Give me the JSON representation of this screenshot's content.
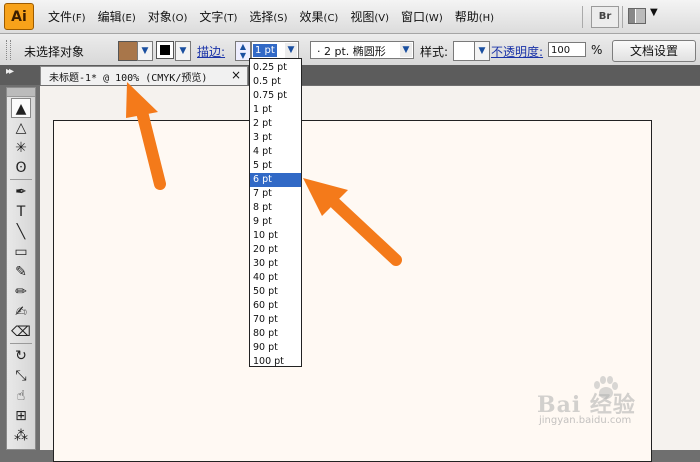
{
  "app": {
    "logo_text": "Ai"
  },
  "menu": {
    "items": [
      {
        "label": "文件",
        "accel": "(F)"
      },
      {
        "label": "编辑",
        "accel": "(E)"
      },
      {
        "label": "对象",
        "accel": "(O)"
      },
      {
        "label": "文字",
        "accel": "(T)"
      },
      {
        "label": "选择",
        "accel": "(S)"
      },
      {
        "label": "效果",
        "accel": "(C)"
      },
      {
        "label": "视图",
        "accel": "(V)"
      },
      {
        "label": "窗口",
        "accel": "(W)"
      },
      {
        "label": "帮助",
        "accel": "(H)"
      }
    ],
    "bridge_label": "Br"
  },
  "control": {
    "no_selection": "未选择对象",
    "fill_color": "#a8764a",
    "stroke_label": "描边:",
    "stroke_weight": "1 pt",
    "brush_text": "·  2 pt. 椭圆形",
    "style_label": "样式:",
    "opacity_label": "不透明度:",
    "opacity_value": "100",
    "opacity_unit": "%",
    "doc_setup": "文档设置"
  },
  "tab": {
    "title": "未标题-1* @ 100% (CMYK/预览)",
    "close": "×"
  },
  "stroke_weights": [
    "0.25 pt",
    "0.5 pt",
    "0.75 pt",
    "1 pt",
    "2 pt",
    "3 pt",
    "4 pt",
    "5 pt",
    "6 pt",
    "7 pt",
    "8 pt",
    "9 pt",
    "10 pt",
    "20 pt",
    "30 pt",
    "40 pt",
    "50 pt",
    "60 pt",
    "70 pt",
    "80 pt",
    "90 pt",
    "100 pt"
  ],
  "selected_weight": "6 pt",
  "tools": [
    {
      "icon": "selection-tool-icon",
      "glyph": "▲"
    },
    {
      "icon": "direct-selection-tool-icon",
      "glyph": "△"
    },
    {
      "icon": "magic-wand-tool-icon",
      "glyph": "✳"
    },
    {
      "icon": "lasso-tool-icon",
      "glyph": "ʘ"
    },
    {
      "icon": "pen-tool-icon",
      "glyph": "✒"
    },
    {
      "icon": "type-tool-icon",
      "glyph": "T"
    },
    {
      "icon": "line-tool-icon",
      "glyph": "╲"
    },
    {
      "icon": "rectangle-tool-icon",
      "glyph": "▭"
    },
    {
      "icon": "paintbrush-tool-icon",
      "glyph": "✎"
    },
    {
      "icon": "pencil-tool-icon",
      "glyph": "✏"
    },
    {
      "icon": "blob-brush-tool-icon",
      "glyph": "✍"
    },
    {
      "icon": "eraser-tool-icon",
      "glyph": "⌫"
    },
    {
      "icon": "rotate-tool-icon",
      "glyph": "↻"
    },
    {
      "icon": "scale-tool-icon",
      "glyph": "⤡"
    },
    {
      "icon": "warp-tool-icon",
      "glyph": "☝"
    },
    {
      "icon": "free-transform-tool-icon",
      "glyph": "⊞"
    },
    {
      "icon": "symbol-sprayer-tool-icon",
      "glyph": "⁂"
    }
  ],
  "watermark": {
    "text": "Bai  经验",
    "url": "jingyan.baidu.com"
  },
  "annotation_color": "#f47a1a"
}
